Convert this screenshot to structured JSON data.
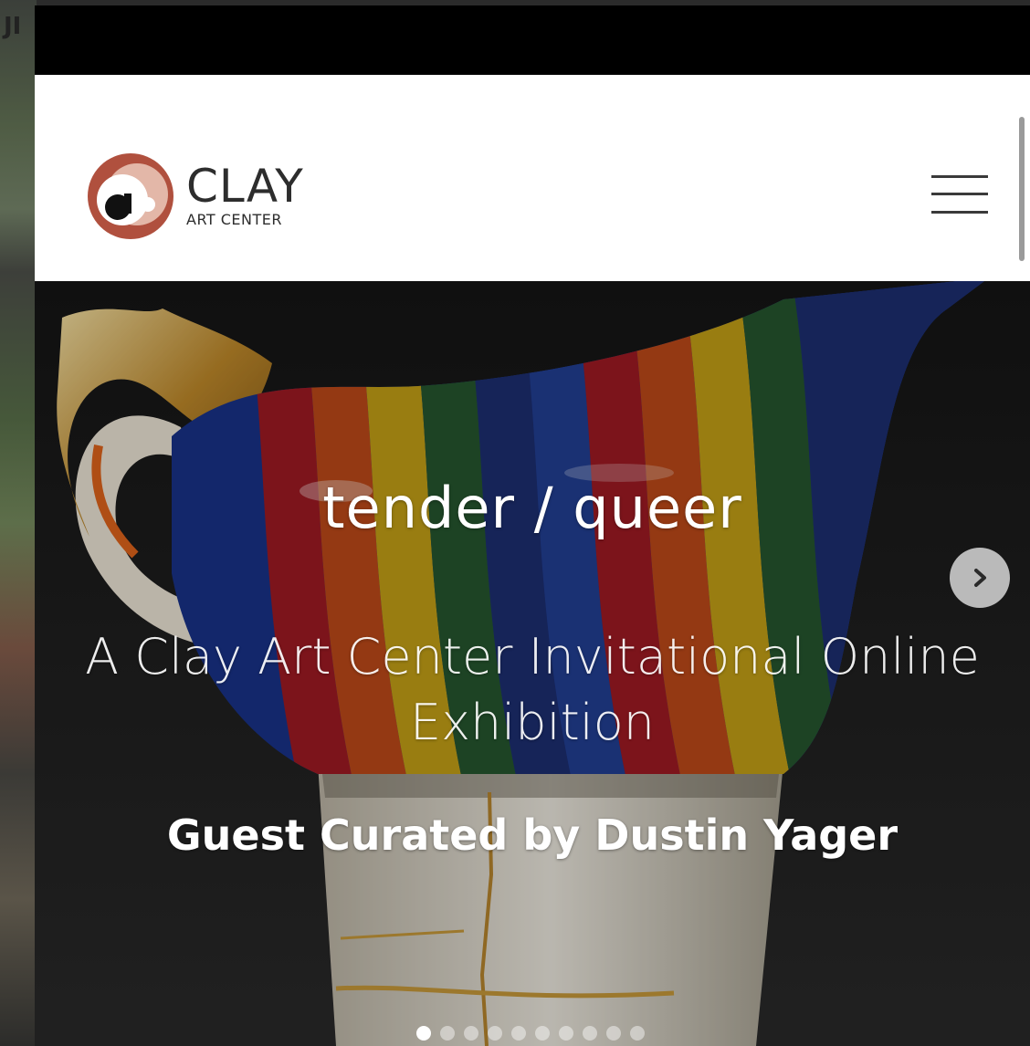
{
  "brand": {
    "name": "CLAY",
    "tagline": "ART CENTER",
    "accent": "#b0503e",
    "logo_fill": "#e3b7a8"
  },
  "header": {
    "menu_icon": "hamburger-menu-icon"
  },
  "hero": {
    "title": "tender / queer",
    "subtitle": "A Clay Art Center Invitational Online Exhibition",
    "curator": "Guest Curated by Dustin Yager",
    "next_icon": "chevron-right-icon",
    "slide_count": 10,
    "active_slide": 1,
    "image_description_colors": [
      "#1f3fa8",
      "#c2202b",
      "#e85a1f",
      "#f0c51b",
      "#2f6b3a",
      "#243a8a"
    ]
  },
  "background": {
    "partial_text": "JI"
  }
}
